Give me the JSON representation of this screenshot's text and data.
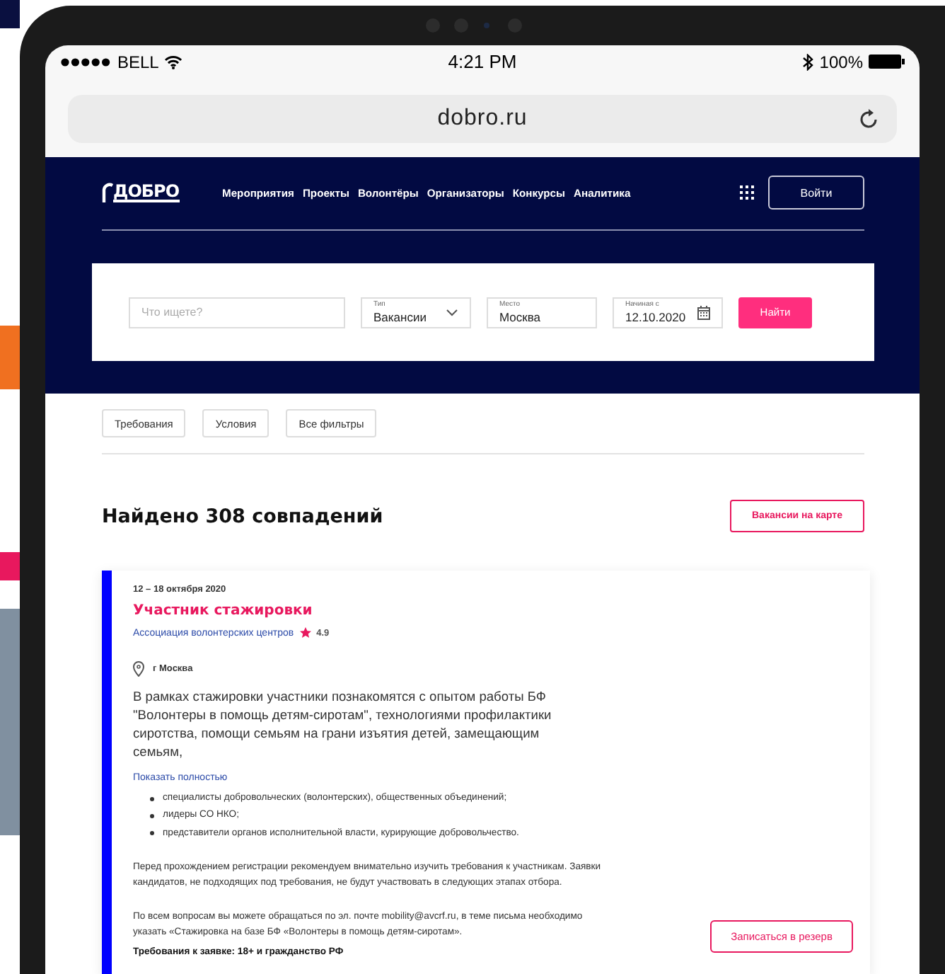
{
  "status_bar": {
    "carrier": "BELL",
    "time": "4:21 PM",
    "battery": "100%"
  },
  "browser": {
    "url": "dobro.ru"
  },
  "header": {
    "logo": "ДОБРО",
    "nav": [
      "Мероприятия",
      "Проекты",
      "Волонтёры",
      "Организаторы",
      "Конкурсы",
      "Аналитика"
    ],
    "login_button": "Войти"
  },
  "search": {
    "query": {
      "placeholder": "Что ищете?"
    },
    "fields": [
      {
        "kind": "select",
        "label": "Тип",
        "value": "Вакансии"
      },
      {
        "kind": "text",
        "label": "Место",
        "value": "Москва"
      },
      {
        "kind": "date",
        "label": "Начиная с",
        "value": "12.10.2020"
      }
    ],
    "button": "Найти"
  },
  "filters": [
    "Требования",
    "Условия",
    "Все фильтры"
  ],
  "results": {
    "heading": "Найдено 308 совпадений",
    "map_button": "Вакансии на карте"
  },
  "card": {
    "dates": "12 – 18 октября 2020",
    "title": "Участник стажировки",
    "organizer": "Ассоциация волонтерских центров",
    "rating": "4.9",
    "location": "г Москва",
    "description": "В рамках стажировки участники познакомятся с опытом работы БФ \"Волонтеры в помощь детям-сиротам\", технологиями профилактики сиротства, помощи семьям на грани изъятия детей, замещающим семьям,",
    "show_more": "Показать полностью",
    "audience": [
      "специалисты добровольческих (волонтерских), общественных объединений;",
      "лидеры СО НКО;",
      "представители органов исполнительной власти, курирующие добровольчество."
    ],
    "notice": "Перед прохождением регистрации рекомендуем внимательно изучить требования к участникам. Заявки кандидатов, не подходящих под требования, не будут участвовать в следующих этапах отбора.",
    "contact": "По всем вопросам вы можете обращаться по эл. почте mobility@avcrf.ru, в теме письма необходимо указать «Стажировка на базе БФ «Волонтеры в помощь детям-сиротам».",
    "requirements": "Требования к заявке: 18+ и гражданство РФ",
    "button": "Записаться в резерв"
  }
}
